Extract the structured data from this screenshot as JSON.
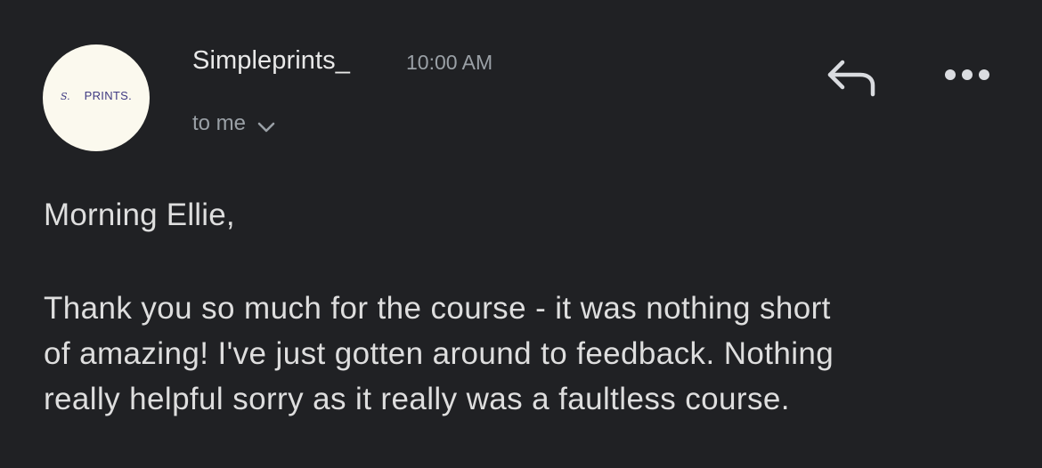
{
  "message": {
    "sender_name": "Simpleprints_",
    "time": "10:00 AM",
    "recipient": "to me",
    "avatar_logo": {
      "initial": "S.",
      "text": "PRINTS."
    },
    "greeting": "Morning Ellie,",
    "body_lines": [
      "Thank you so much for the course - it was nothing short",
      "of amazing! I've just gotten around to feedback. Nothing",
      "really helpful sorry as it really was a faultless course."
    ]
  },
  "icons": {
    "reply": "reply-icon",
    "more": "more-options-icon",
    "expand": "chevron-down-icon"
  },
  "colors": {
    "background": "#202124",
    "avatar_bg": "#fbf9ee",
    "logo": "#3f3a82",
    "secondary_text": "#9aa0a6",
    "primary_text": "#e3e3e3"
  }
}
